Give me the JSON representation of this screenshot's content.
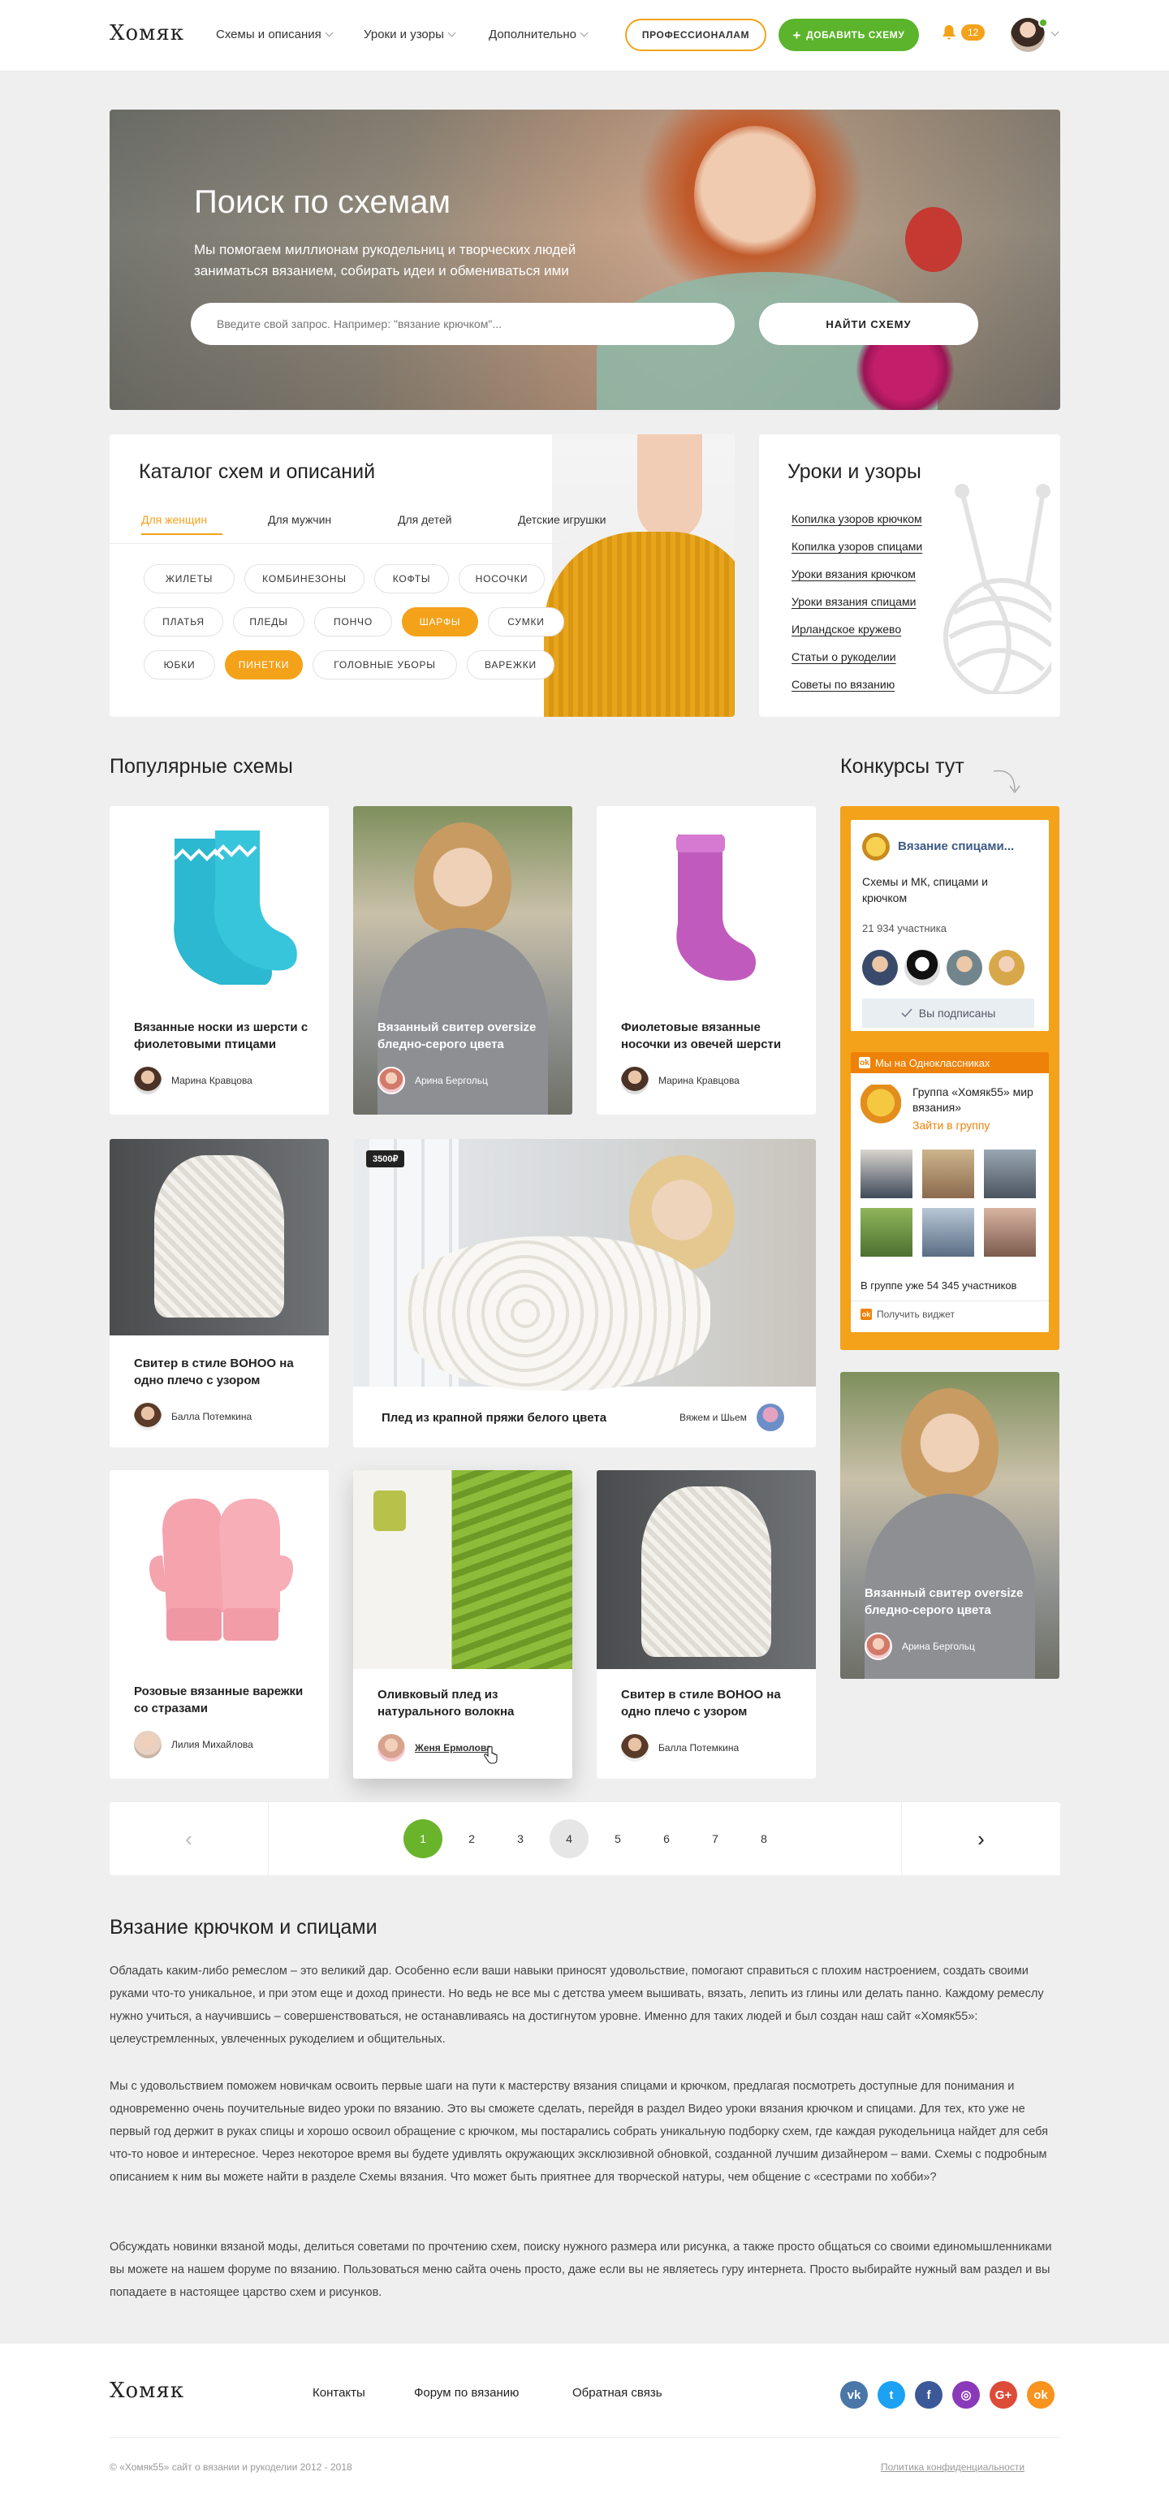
{
  "header": {
    "logo": "Хомяк",
    "nav": [
      {
        "label": "Схемы и описания"
      },
      {
        "label": "Уроки и узоры"
      },
      {
        "label": "Дополнительно"
      }
    ],
    "pro_button": "ПРОФЕССИОНАЛАМ",
    "add_button": "ДОБАВИТЬ СХЕМУ",
    "notifications": "12"
  },
  "hero": {
    "title": "Поиск по схемам",
    "subtitle": "Мы помогаем миллионам рукодельниц и творческих людей заниматься вязанием, собирать идеи и обмениваться ими",
    "search_placeholder": "Введите свой запрос. Например: \"вязание крючком\"...",
    "search_button": "НАЙТИ СХЕМУ"
  },
  "catalog": {
    "title": "Каталог схем и описаний",
    "tabs": [
      "Для женщин",
      "Для мужчин",
      "Для детей",
      "Детские игрушки"
    ],
    "pills_row1": [
      "ЖИЛЕТЫ",
      "КОМБИНЕЗОНЫ",
      "КОФТЫ",
      "НОСОЧКИ"
    ],
    "pills_row2": [
      "ПЛАТЬЯ",
      "ПЛЕДЫ",
      "ПОНЧО",
      "ШАРФЫ",
      "СУМКИ"
    ],
    "pills_row3": [
      "ЮБКИ",
      "ПИНЕТКИ",
      "ГОЛОВНЫЕ УБОРЫ",
      "ВАРЕЖКИ"
    ]
  },
  "lessons": {
    "title": "Уроки и узоры",
    "links": [
      "Копилка узоров крючком",
      "Копилка узоров спицами",
      "Уроки вязания крючком",
      "Уроки вязания спицами",
      "Ирландское кружево",
      "Статьи о рукоделии",
      "Советы по вязанию"
    ]
  },
  "popular": {
    "title": "Популярные схемы",
    "cards": [
      {
        "title": "Вязанные носки из шерсти с фиолетовыми птицами",
        "author": "Марина Кравцова"
      },
      {
        "title": "Вязанный свитер oversize бледно-серого цвета",
        "author": "Арина Бергольц"
      },
      {
        "title": "Фиолетовые вязанные носочки из овечей шерсти",
        "author": "Марина Кравцова"
      },
      {
        "title": "Свитер в стиле BOHOO на одно плечо с узором",
        "author": "Балла Потемкина"
      },
      {
        "title": "Плед из крапной пряжи белого цвета",
        "author": "Вяжем и Шьем",
        "price": "3500₽"
      },
      {
        "title": "Розовые вязанные варежки со стразами",
        "author": "Лилия Михайлова"
      },
      {
        "title": "Оливковый плед из натурального волокна",
        "author": "Женя Ермолова"
      },
      {
        "title": "Свитер в стиле BOHOO на одно плечо с узором",
        "author": "Балла Потемкина"
      }
    ]
  },
  "contest": {
    "title": "Конкурсы тут",
    "group_name": "Вязание спицами...",
    "group_desc": "Схемы и МК, спицами и крючком",
    "members": "21 934 участника",
    "subscribed": "Вы подписаны",
    "ok_header": "Мы на Одноклассниках",
    "ok_group": "Группа «Хомяк55» мир вязания»",
    "ok_join": "Зайти в группу",
    "ok_count": "В группе уже 54 345 участников",
    "ok_widget": "Получить виджет",
    "side_card_title": "Вязанный свитер oversize бледно-серого цвета",
    "side_card_author": "Арина Бергольц"
  },
  "pagination": {
    "prev": "‹",
    "next": "›",
    "pages": [
      "1",
      "2",
      "3",
      "4",
      "5",
      "6",
      "7",
      "8"
    ],
    "active": 1
  },
  "seo": {
    "title": "Вязание крючком и спицами",
    "p1": "Обладать каким-либо ремеслом – это великий дар. Особенно если ваши навыки приносят удовольствие, помогают справиться с плохим настроением, создать своими руками что-то уникальное, и при этом еще и доход принести. Но ведь не все мы с детства умеем вышивать, вязать, лепить из глины или делать панно. Каждому ремеслу нужно учиться, а научившись – совершенствоваться, не останавливаясь на достигнутом уровне. Именно для таких людей и был создан наш сайт «Хомяк55»: целеустремленных, увлеченных рукоделием и общительных.",
    "p2": "Мы с удовольствием поможем новичкам освоить первые шаги на пути к мастерству вязания спицами и крючком, предлагая посмотреть доступные для понимания и одновременно очень поучительные видео уроки по вязанию. Это вы сможете сделать, перейдя в раздел Видео уроки вязания крючком и спицами. Для тех, кто уже не первый год держит в руках спицы и хорошо освоил обращение с крючком, мы постарались собрать уникальную подборку схем, где каждая рукодельница найдет для себя что-то новое и интересное. Через некоторое время вы будете удивлять окружающих эксклюзивной обновкой, созданной лучшим дизайнером – вами. Схемы с подробным описанием к ним вы можете найти в разделе Схемы вязания. Что может быть приятнее для творческой натуры, чем общение с «сестрами по хобби»?",
    "p3": "Обсуждать новинки вязаной моды, делиться советами по прочтению схем, поиску нужного размера или рисунка, а также просто общаться со своими единомышленниками вы можете на нашем форуме по вязанию. Пользоваться меню сайта очень просто, даже если вы не являетесь гуру интернета. Просто выбирайте нужный вам раздел и вы попадаете в настоящее царство схем и рисунков."
  },
  "footer": {
    "logo": "Хомяк",
    "links": [
      "Контакты",
      "Форум по вязанию",
      "Обратная связь"
    ],
    "copyright": "© «Хомяк55» сайт о вязании и рукоделии 2012 - 2018",
    "privacy": "Политика конфиденциальности",
    "social": [
      {
        "icon": "vk-icon",
        "glyph": "vk",
        "color": "#4a76a8"
      },
      {
        "icon": "twitter-icon",
        "glyph": "t",
        "color": "#1da1f2"
      },
      {
        "icon": "facebook-icon",
        "glyph": "f",
        "color": "#3b5998"
      },
      {
        "icon": "instagram-icon",
        "glyph": "◎",
        "color": "#8a3ab9"
      },
      {
        "icon": "googleplus-icon",
        "glyph": "G+",
        "color": "#dd4b39"
      },
      {
        "icon": "odnoklassniki-icon",
        "glyph": "ok",
        "color": "#f7931e"
      }
    ]
  },
  "colors": {
    "accent": "#f3a21a",
    "green": "#5bb42b",
    "ok_orange": "#ee8208"
  }
}
